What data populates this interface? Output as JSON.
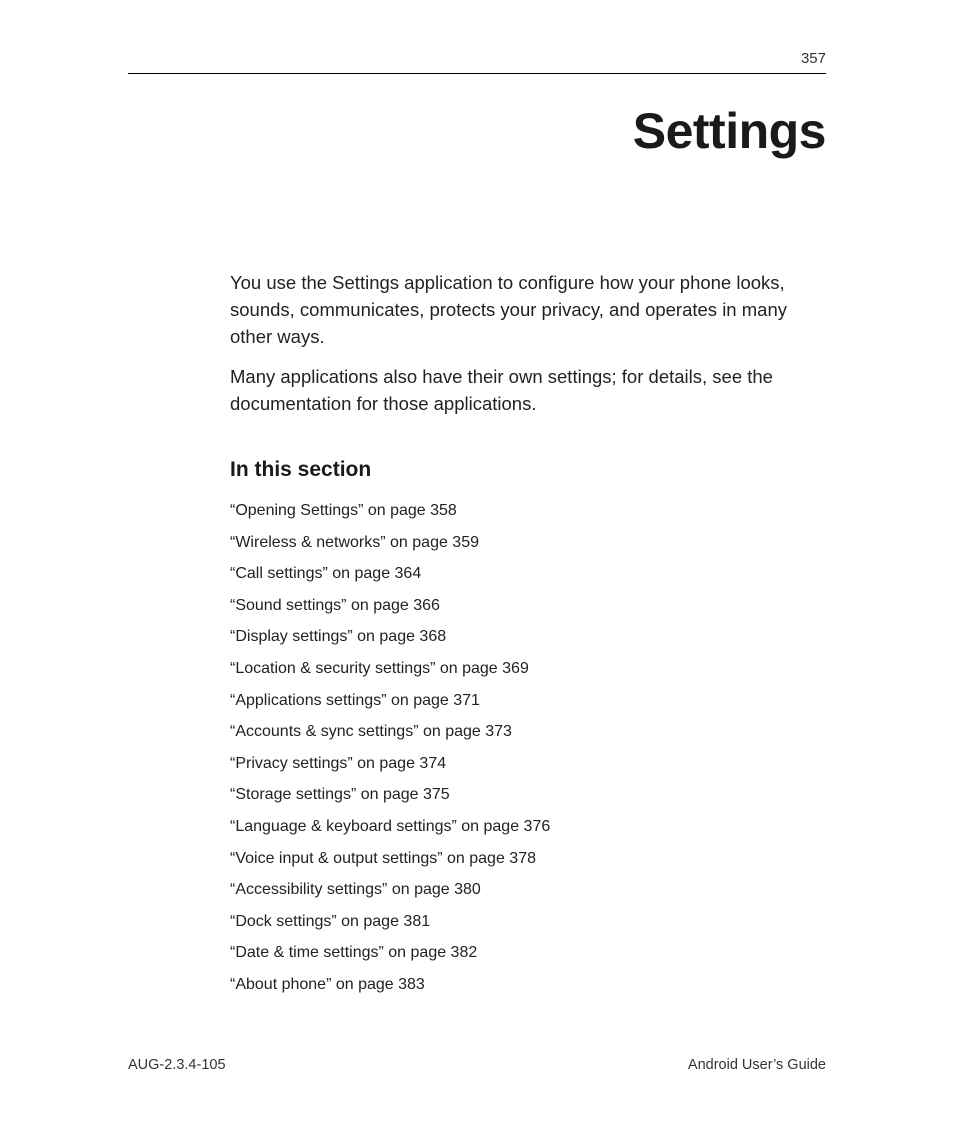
{
  "page_number": "357",
  "title": "Settings",
  "paragraphs": [
    "You use the Settings application to configure how your phone looks, sounds, communicates, protects your privacy, and operates in many other ways.",
    "Many applications also have their own settings; for details, see the documentation for those applications."
  ],
  "subhead": "In this section",
  "toc": [
    "“Opening Settings” on page 358",
    "“Wireless & networks” on page 359",
    "“Call settings” on page 364",
    "“Sound settings” on page 366",
    "“Display settings” on page 368",
    "“Location & security settings” on page 369",
    "“Applications settings” on page 371",
    "“Accounts & sync settings” on page 373",
    "“Privacy settings” on page 374",
    "“Storage settings” on page 375",
    "“Language & keyboard settings” on page 376",
    "“Voice input & output settings” on page 378",
    "“Accessibility settings” on page 380",
    "“Dock settings” on page 381",
    "“Date & time settings” on page 382",
    "“About phone” on page 383"
  ],
  "footer": {
    "left": "AUG-2.3.4-105",
    "right": "Android User’s Guide"
  }
}
